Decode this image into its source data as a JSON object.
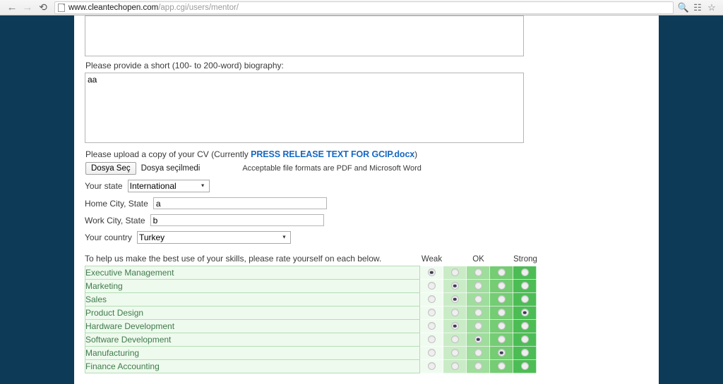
{
  "browser": {
    "back_icon": "back-arrow-icon",
    "forward_icon": "forward-arrow-icon",
    "reload_icon": "reload-icon",
    "url_host": "www.cleantechopen.com",
    "url_path": "/app.cgi/users/mentor/",
    "zoom_icon": "magnifier-icon",
    "extension_icon": "extension-icon",
    "bookmark_icon": "star-icon"
  },
  "form": {
    "top_textarea_value": "",
    "bio_label": "Please provide a short (100- to 200-word) biography:",
    "bio_value": "aa",
    "cv_prefix": "Please upload a copy of your CV (Currently ",
    "cv_filename": "PRESS RELEASE TEXT FOR GCIP.docx",
    "cv_suffix": ")",
    "file_button_label": "Dosya Seç",
    "file_status": "Dosya seçilmedi",
    "file_hint": "Acceptable file formats are PDF and Microsoft Word",
    "state_label": "Your state",
    "state_value": "International",
    "home_city_label": "Home City, State",
    "home_city_value": "a",
    "work_city_label": "Work City, State",
    "work_city_value": "b",
    "country_label": "Your country",
    "country_value": "Turkey"
  },
  "skills": {
    "prompt": "To help us make the best use of your skills, please rate yourself on each below.",
    "scale_labels": [
      "Weak",
      "",
      "OK",
      "",
      "Strong"
    ],
    "column_colors": [
      "#f0fbf0",
      "#c9ecc6",
      "#9fdd9c",
      "#74cc73",
      "#4cbd55"
    ],
    "rows": [
      {
        "label": "Executive Management",
        "selected": 1
      },
      {
        "label": "Marketing",
        "selected": 2
      },
      {
        "label": "Sales",
        "selected": 2
      },
      {
        "label": "Product Design",
        "selected": 5
      },
      {
        "label": "Hardware Development",
        "selected": 2
      },
      {
        "label": "Software Development",
        "selected": 3
      },
      {
        "label": "Manufacturing",
        "selected": 4
      },
      {
        "label": "Finance Accounting",
        "selected": 0
      }
    ]
  },
  "colors": {
    "page_background": "#0d3a56",
    "content_background": "#ffffff",
    "link": "#1668c1",
    "skill_text": "#3f7a4a"
  }
}
